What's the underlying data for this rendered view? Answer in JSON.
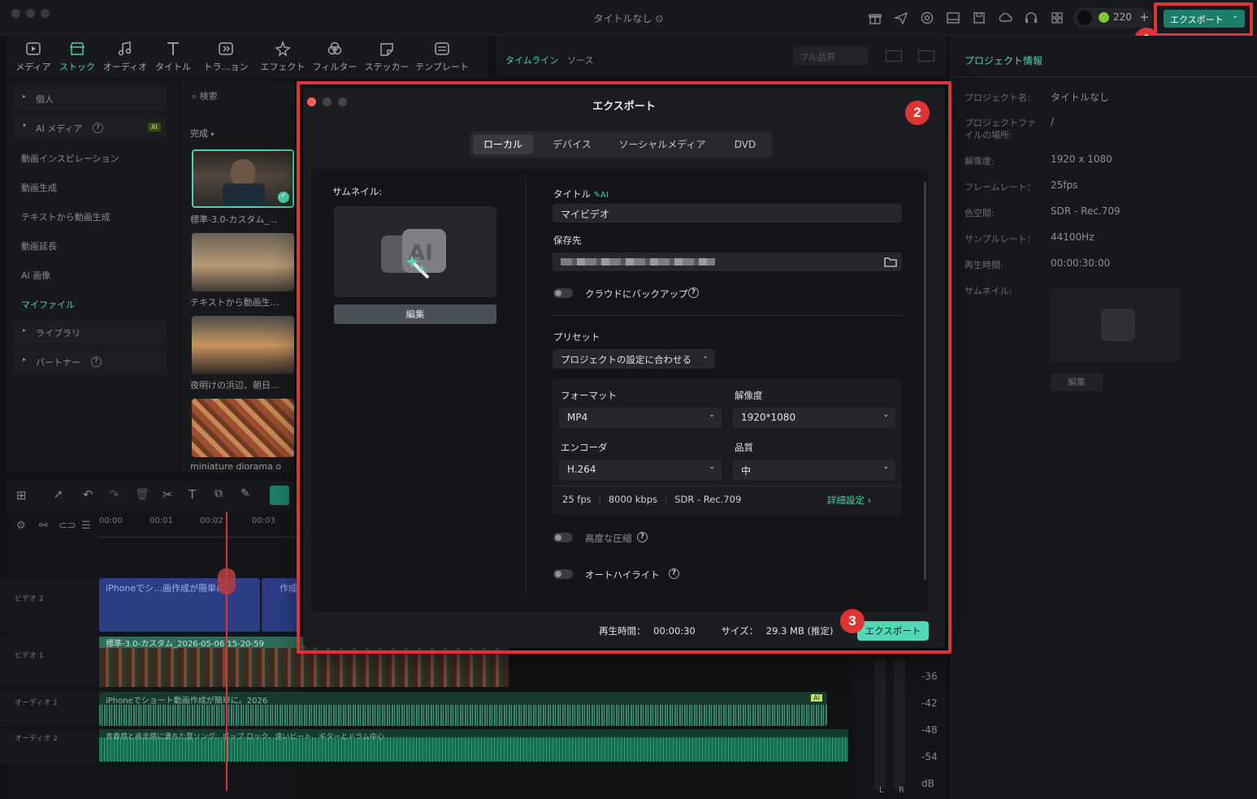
{
  "window": {
    "title": "タイトルなし"
  },
  "topbar": {
    "credits": "220",
    "export_label": "エクスポート"
  },
  "media_tabs": [
    {
      "label": "メディア",
      "icon": "media-icon"
    },
    {
      "label": "ストック",
      "icon": "stock-icon",
      "active": true
    },
    {
      "label": "オーディオ",
      "icon": "music-icon"
    },
    {
      "label": "タイトル",
      "icon": "title-icon"
    },
    {
      "label": "トラ…ョン",
      "icon": "transition-icon"
    },
    {
      "label": "エフェクト",
      "icon": "effect-icon"
    },
    {
      "label": "フィルター",
      "icon": "filter-icon"
    },
    {
      "label": "ステッカー",
      "icon": "sticker-icon"
    },
    {
      "label": "テンプレート",
      "icon": "template-icon"
    }
  ],
  "sidebar": {
    "personal": "個人",
    "ai_media": "AI メディア",
    "ai_badge": "AI",
    "items": [
      "動画インスピレーション",
      "動画生成",
      "テキストから動画生成",
      "動画延長",
      "AI 画像",
      "マイファイル"
    ],
    "library": "ライブラリ",
    "partner": "パートナー"
  },
  "library": {
    "search_placeholder": "検索",
    "filter": "完成",
    "items": [
      "標準-3.0-カスタム_...",
      "テキストから動画生…",
      "夜明けの浜辺、朝日…",
      "miniature diorama o"
    ]
  },
  "preview_header": {
    "timeline": "タイムライン",
    "source": "ソース",
    "quality": "フル品質"
  },
  "timeline": {
    "ruler": [
      "00:00",
      "00:01",
      "00:02",
      "00:03"
    ],
    "tracks": {
      "video2": "ビデオ 2",
      "video1": "ビデオ 1",
      "audio1": "オーディオ 1",
      "audio2": "オーディオ 2"
    },
    "clips": {
      "v2a": "iPhoneでシ…画作成が簡単に。",
      "v2b": "作成",
      "v1": "標準-3.0-カスタム_2026-05-06 15-20-59",
      "a1": "iPhoneでショート動画作成が簡単に。2026",
      "a2": "青春感と疾走感に満ちた夏ソング、ポップ ロック、速いビート、ギターとドラム中心",
      "a1_badge": "AI"
    }
  },
  "meter": {
    "labels": [
      "-36",
      "-42",
      "-48",
      "-54",
      "dB"
    ],
    "l": "L",
    "r": "R"
  },
  "project": {
    "header": "プロジェクト情報",
    "rows": [
      {
        "label": "プロジェクト名:",
        "value": "タイトルなし"
      },
      {
        "label": "プロジェクトファイルの場所:",
        "value": "/"
      },
      {
        "label": "解像度:",
        "value": "1920 x 1080"
      },
      {
        "label": "フレームレート：",
        "value": "25fps"
      },
      {
        "label": "色空間:",
        "value": "SDR - Rec.709"
      },
      {
        "label": "サンプルレート：",
        "value": "44100Hz"
      },
      {
        "label": "再生時間:",
        "value": "00:00:30:00"
      }
    ],
    "thumbnail_label": "サムネイル:",
    "edit": "編集"
  },
  "dialog": {
    "title": "エクスポート",
    "tabs": [
      "ローカル",
      "デバイス",
      "ソーシャルメディア",
      "DVD"
    ],
    "thumbnail_label": "サムネイル:",
    "edit_button": "編集",
    "title_label": "タイトル",
    "title_value": "マイビデオ",
    "save_to_label": "保存先",
    "cloud_backup": "クラウドにバックアップ",
    "preset_label": "プリセット",
    "preset_value": "プロジェクトの設定に合わせる",
    "format_label": "フォーマット",
    "format_value": "MP4",
    "resolution_label": "解像度",
    "resolution_value": "1920*1080",
    "encoder_label": "エンコーダ",
    "encoder_value": "H.264",
    "quality_label": "品質",
    "quality_value": "中",
    "fps": "25 fps",
    "bitrate": "8000 kbps",
    "color": "SDR - Rec.709",
    "advanced": "詳細設定",
    "advanced_compression": "高度な圧縮",
    "auto_highlight": "オートハイライト",
    "duration_label": "再生時間：",
    "duration_value": "00:00:30",
    "size_label": "サイズ：",
    "size_value": "29.3 MB (推定)",
    "export_button": "エクスポート"
  },
  "annotations": {
    "step1": "1",
    "step2": "2",
    "step3": "3"
  },
  "colors": {
    "accent": "#49d3b1",
    "export_green": "#4fd9b7",
    "annotation_red": "#e03434"
  }
}
